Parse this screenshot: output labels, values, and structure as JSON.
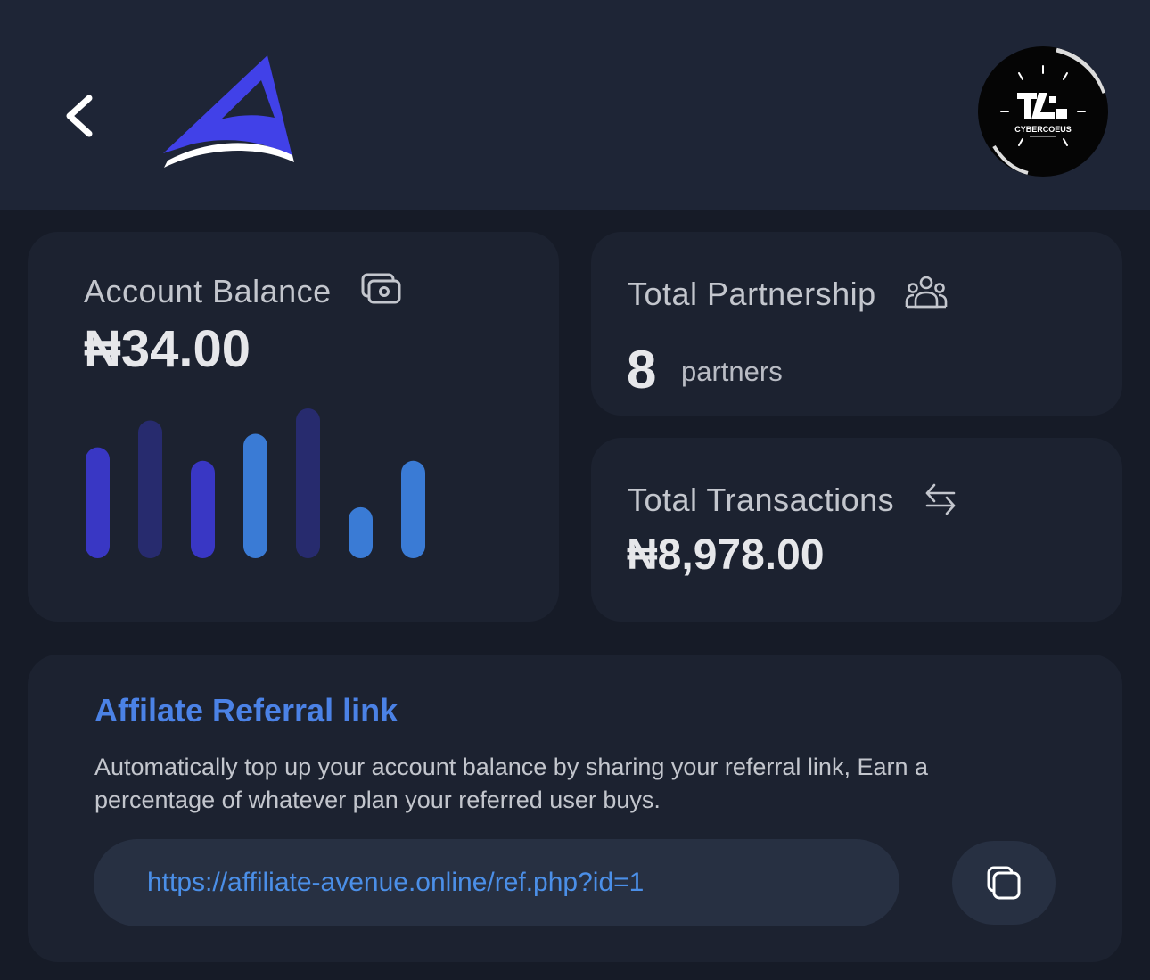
{
  "header": {
    "avatar_text": "CYBERCOEUS"
  },
  "balance": {
    "label": "Account Balance",
    "value": "₦34.00",
    "bars": [
      {
        "level": 0.74,
        "color": "#3937c4"
      },
      {
        "level": 0.92,
        "color": "#272b6e"
      },
      {
        "level": 0.65,
        "color": "#3937c4"
      },
      {
        "level": 0.83,
        "color": "#3a7bd5"
      },
      {
        "level": 1.0,
        "color": "#272b6e"
      },
      {
        "level": 0.34,
        "color": "#3a7bd5"
      },
      {
        "level": 0.65,
        "color": "#3a7bd5"
      }
    ]
  },
  "partnership": {
    "label": "Total Partnership",
    "count": "8",
    "unit": "partners"
  },
  "transactions": {
    "label": "Total Transactions",
    "value": "₦8,978.00"
  },
  "referral": {
    "title": "Affilate Referral link",
    "description": "Automatically top up your account balance by sharing your referral link, Earn a percentage of whatever plan your referred user buys.",
    "link": "https://affiliate-avenue.online/ref.php?id=1"
  },
  "colors": {
    "accent": "#4b82e6",
    "logo": "#4141e8",
    "bar_dark": "#272b6e",
    "bar_mid": "#3937c4",
    "bar_light": "#3a7bd5"
  },
  "icons": {
    "back": "chevron-left-icon",
    "balance": "cash-icon",
    "partners": "users-group-icon",
    "transactions": "arrows-exchange-icon",
    "copy": "copy-icon"
  }
}
